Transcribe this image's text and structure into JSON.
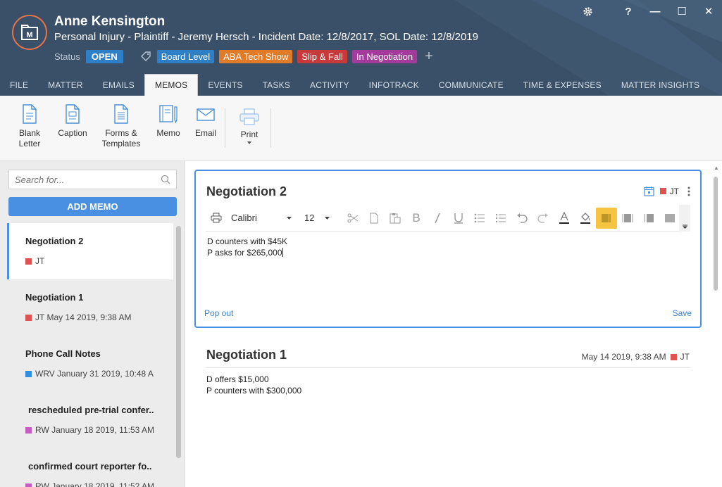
{
  "header": {
    "client_name": "Anne Kensington",
    "matter_desc": "Personal Injury - Plaintiff - Jeremy Hersch - Incident Date: 12/8/2017, SOL Date: 12/8/2019",
    "status_label": "Status",
    "status_value": "OPEN",
    "tags": [
      {
        "label": "Board Level",
        "color": "#2e7fc5"
      },
      {
        "label": "ABA Tech Show",
        "color": "#e07b2a"
      },
      {
        "label": "Slip & Fall",
        "color": "#c8393b"
      },
      {
        "label": "In Negotiation",
        "color": "#a23b9c"
      }
    ],
    "add_tag": "+",
    "window_controls": {
      "help": "?",
      "minimize": "—",
      "maximize": "☐",
      "close": "✕"
    }
  },
  "nav": {
    "tabs": [
      "FILE",
      "MATTER",
      "EMAILS",
      "MEMOS",
      "EVENTS",
      "TASKS",
      "ACTIVITY",
      "INFOTRACK",
      "COMMUNICATE",
      "TIME & EXPENSES",
      "MATTER INSIGHTS"
    ],
    "active": "MEMOS"
  },
  "ribbon": {
    "blank_letter": "Blank\nLetter",
    "caption": "Caption",
    "forms_templates": "Forms &\nTemplates",
    "memo": "Memo",
    "email": "Email",
    "print": "Print"
  },
  "left": {
    "search_placeholder": "Search for...",
    "add_memo": "ADD MEMO",
    "memos": [
      {
        "title": "Negotiation 2",
        "meta": "JT",
        "color": "#e05252",
        "selected": true
      },
      {
        "title": "Negotiation 1",
        "meta": "JT May 14 2019, 9:38 AM",
        "color": "#e05252"
      },
      {
        "title": "Phone Call Notes",
        "meta": "WRV January 31 2019, 10:48 A",
        "color": "#2e8fe0"
      },
      {
        "title": "rescheduled pre-trial confer..",
        "meta": "RW January 18 2019, 11:53 AM",
        "color": "#c95cc4"
      },
      {
        "title": "confirmed court reporter fo..",
        "meta": "RW January 18 2019, 11:52 AM",
        "color": "#c95cc4"
      }
    ]
  },
  "editor": {
    "title": "Negotiation 2",
    "initials": "JT",
    "initials_color": "#e05252",
    "font": "Calibri",
    "size": "12",
    "line1": "D counters with $45K",
    "line2": "P asks for $265,000",
    "popout": "Pop out",
    "save": "Save"
  },
  "memo_view": {
    "title": "Negotiation 1",
    "date": "May 14 2019, 9:38 AM",
    "initials": "JT",
    "initials_color": "#e05252",
    "line1": "D offers $15,000",
    "line2": "P counters with $300,000"
  }
}
